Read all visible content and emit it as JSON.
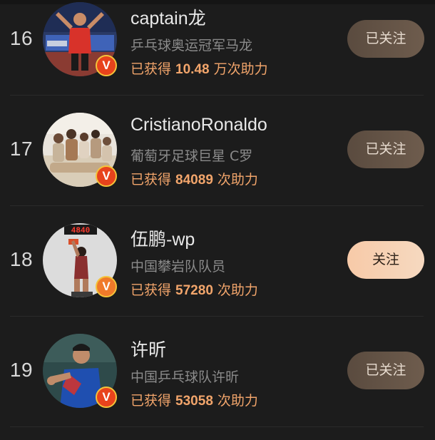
{
  "colors": {
    "background": "#1c1c1c",
    "accent_help": "#f2a56b",
    "followed_button": "#5f4f42",
    "follow_button": "#f7caa8",
    "verify_badge": "#e8431c"
  },
  "rows": [
    {
      "rank": "16",
      "name": "captain龙",
      "description": "乒乓球奥运冠军马龙",
      "help_prefix": "已获得 ",
      "help_value": "10.48",
      "help_suffix": " 万次助力",
      "button_label": "已关注",
      "button_state": "followed",
      "badge_icon": "verified-v-icon"
    },
    {
      "rank": "17",
      "name": "CristianoRonaldo",
      "description": "葡萄牙足球巨星 C罗",
      "help_prefix": "已获得 ",
      "help_value": "84089",
      "help_suffix": " 次助力",
      "button_label": "已关注",
      "button_state": "followed",
      "badge_icon": "verified-v-icon"
    },
    {
      "rank": "18",
      "name": "伍鹏-wp",
      "description": "中国攀岩队队员",
      "help_prefix": "已获得 ",
      "help_value": "57280",
      "help_suffix": " 次助力",
      "button_label": "关注",
      "button_state": "not_followed",
      "badge_icon": "verified-v-icon",
      "avatar_scoreboard": "4840"
    },
    {
      "rank": "19",
      "name": "许昕",
      "description": "中国乒乓球队许昕",
      "help_prefix": "已获得 ",
      "help_value": "53058",
      "help_suffix": " 次助力",
      "button_label": "已关注",
      "button_state": "followed",
      "badge_icon": "verified-v-icon"
    }
  ],
  "badge_letter": "V"
}
